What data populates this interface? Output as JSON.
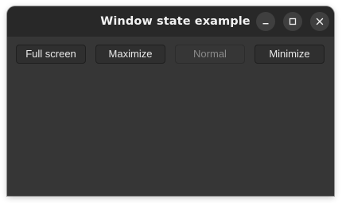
{
  "window": {
    "title": "Window state example"
  },
  "window_controls": {
    "minimize_icon": "minimize-icon",
    "maximize_icon": "maximize-icon",
    "close_icon": "close-icon"
  },
  "actions": [
    {
      "label": "Full screen",
      "enabled": true
    },
    {
      "label": "Maximize",
      "enabled": true
    },
    {
      "label": "Normal",
      "enabled": false
    },
    {
      "label": "Minimize",
      "enabled": true
    }
  ],
  "colors": {
    "titlebar": "#282828",
    "content": "#363636",
    "text": "#e8e8e8",
    "disabled_text": "#8a8a8a"
  }
}
